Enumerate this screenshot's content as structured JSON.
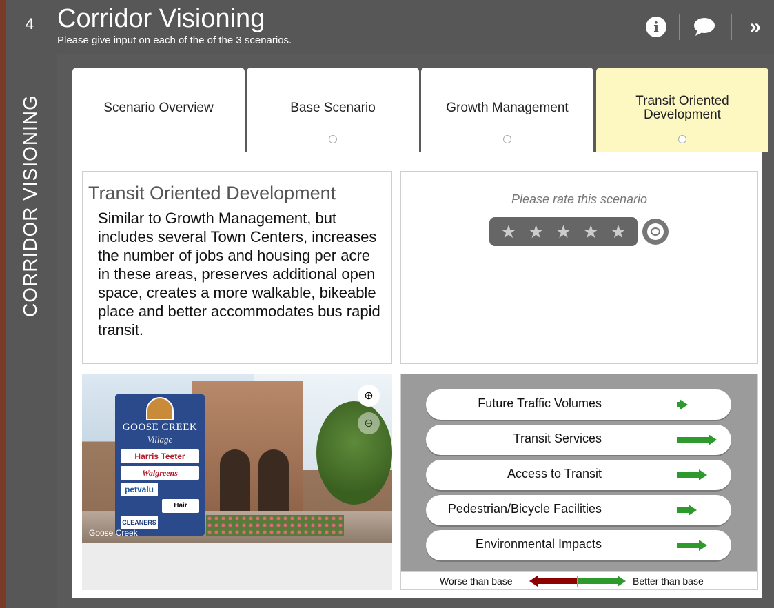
{
  "step": {
    "number": "4"
  },
  "rail": {
    "title": "CORRIDOR VISIONING"
  },
  "header": {
    "title": "Corridor Visioning",
    "subtitle": "Please give input on each of the of the 3 scenarios.",
    "info_icon": "info-icon",
    "chat_icon": "chat-icon",
    "expand_icon": "double-chevron-right-icon",
    "info_glyph": "i",
    "expand_glyph": "»"
  },
  "tabs": [
    {
      "label": "Scenario Overview",
      "active": false,
      "has_dot": false
    },
    {
      "label": "Base Scenario",
      "active": false,
      "has_dot": true
    },
    {
      "label": "Growth Management",
      "active": false,
      "has_dot": true
    },
    {
      "label": "Transit Oriented Development",
      "active": true,
      "has_dot": true
    }
  ],
  "description": {
    "title": "Transit Oriented Development",
    "text": "Similar to Growth Management, but includes several Town Centers, increases the number of jobs and housing per acre in these areas, preserves additional open space, creates a more walkable, bikeable place and better accommodates bus rapid transit."
  },
  "rating": {
    "prompt": "Please rate this scenario",
    "stars": 5,
    "star_glyph": "★",
    "selected": 0,
    "comment_icon": "comment-icon"
  },
  "photo": {
    "caption": "Goose Creek",
    "sign_name": "GOOSE CREEK",
    "sign_sub": "Village",
    "sign_tenants": [
      "Harris Teeter",
      "Walgreens",
      "petvalu",
      "Hair Cuttery",
      "CLEANERS"
    ],
    "zoom_in_icon": "zoom-in-icon",
    "zoom_out_icon": "zoom-out-icon",
    "zoom_in_glyph": "⊕",
    "zoom_out_glyph": "⊖"
  },
  "impacts": [
    {
      "label": "Future Traffic Volumes",
      "level": 0.25
    },
    {
      "label": "Transit Services",
      "level": 1.0
    },
    {
      "label": "Access to Transit",
      "level": 0.75
    },
    {
      "label": "Pedestrian/Bicycle Facilities",
      "level": 0.5
    },
    {
      "label": "Environmental Impacts",
      "level": 0.75
    }
  ],
  "legend": {
    "worse": "Worse than base",
    "better": "Better than base"
  },
  "colors": {
    "active_tab": "#fdf8c2",
    "better": "#2e9a2e",
    "worse": "#8b0000",
    "chrome": "#575757"
  }
}
